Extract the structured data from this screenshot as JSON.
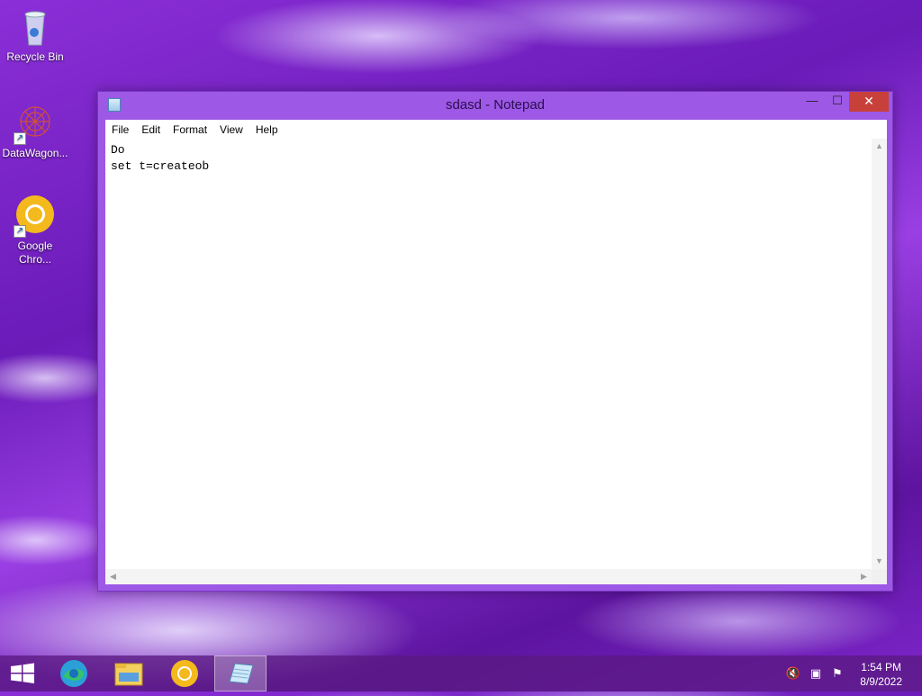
{
  "desktop": {
    "icons": [
      {
        "label": "Recycle Bin"
      },
      {
        "label": "DataWagon..."
      },
      {
        "label_line1": "Google",
        "label_line2": "Chro..."
      }
    ]
  },
  "window": {
    "title": "sdasd - Notepad",
    "controls": {
      "minimize": "—",
      "maximize": "☐",
      "close": "✕"
    },
    "menu": [
      "File",
      "Edit",
      "Format",
      "View",
      "Help"
    ],
    "content": "Do\nset t=createob"
  },
  "taskbar": {
    "items": [
      "start",
      "edge",
      "file-explorer",
      "chrome",
      "notepad"
    ],
    "active_item": "notepad",
    "clock": {
      "time": "1:54 PM",
      "date": "8/9/2022"
    }
  },
  "colors": {
    "window_frame": "#9d58e6",
    "close_button": "#c7403a",
    "desktop_accent": "#7e26cc"
  }
}
